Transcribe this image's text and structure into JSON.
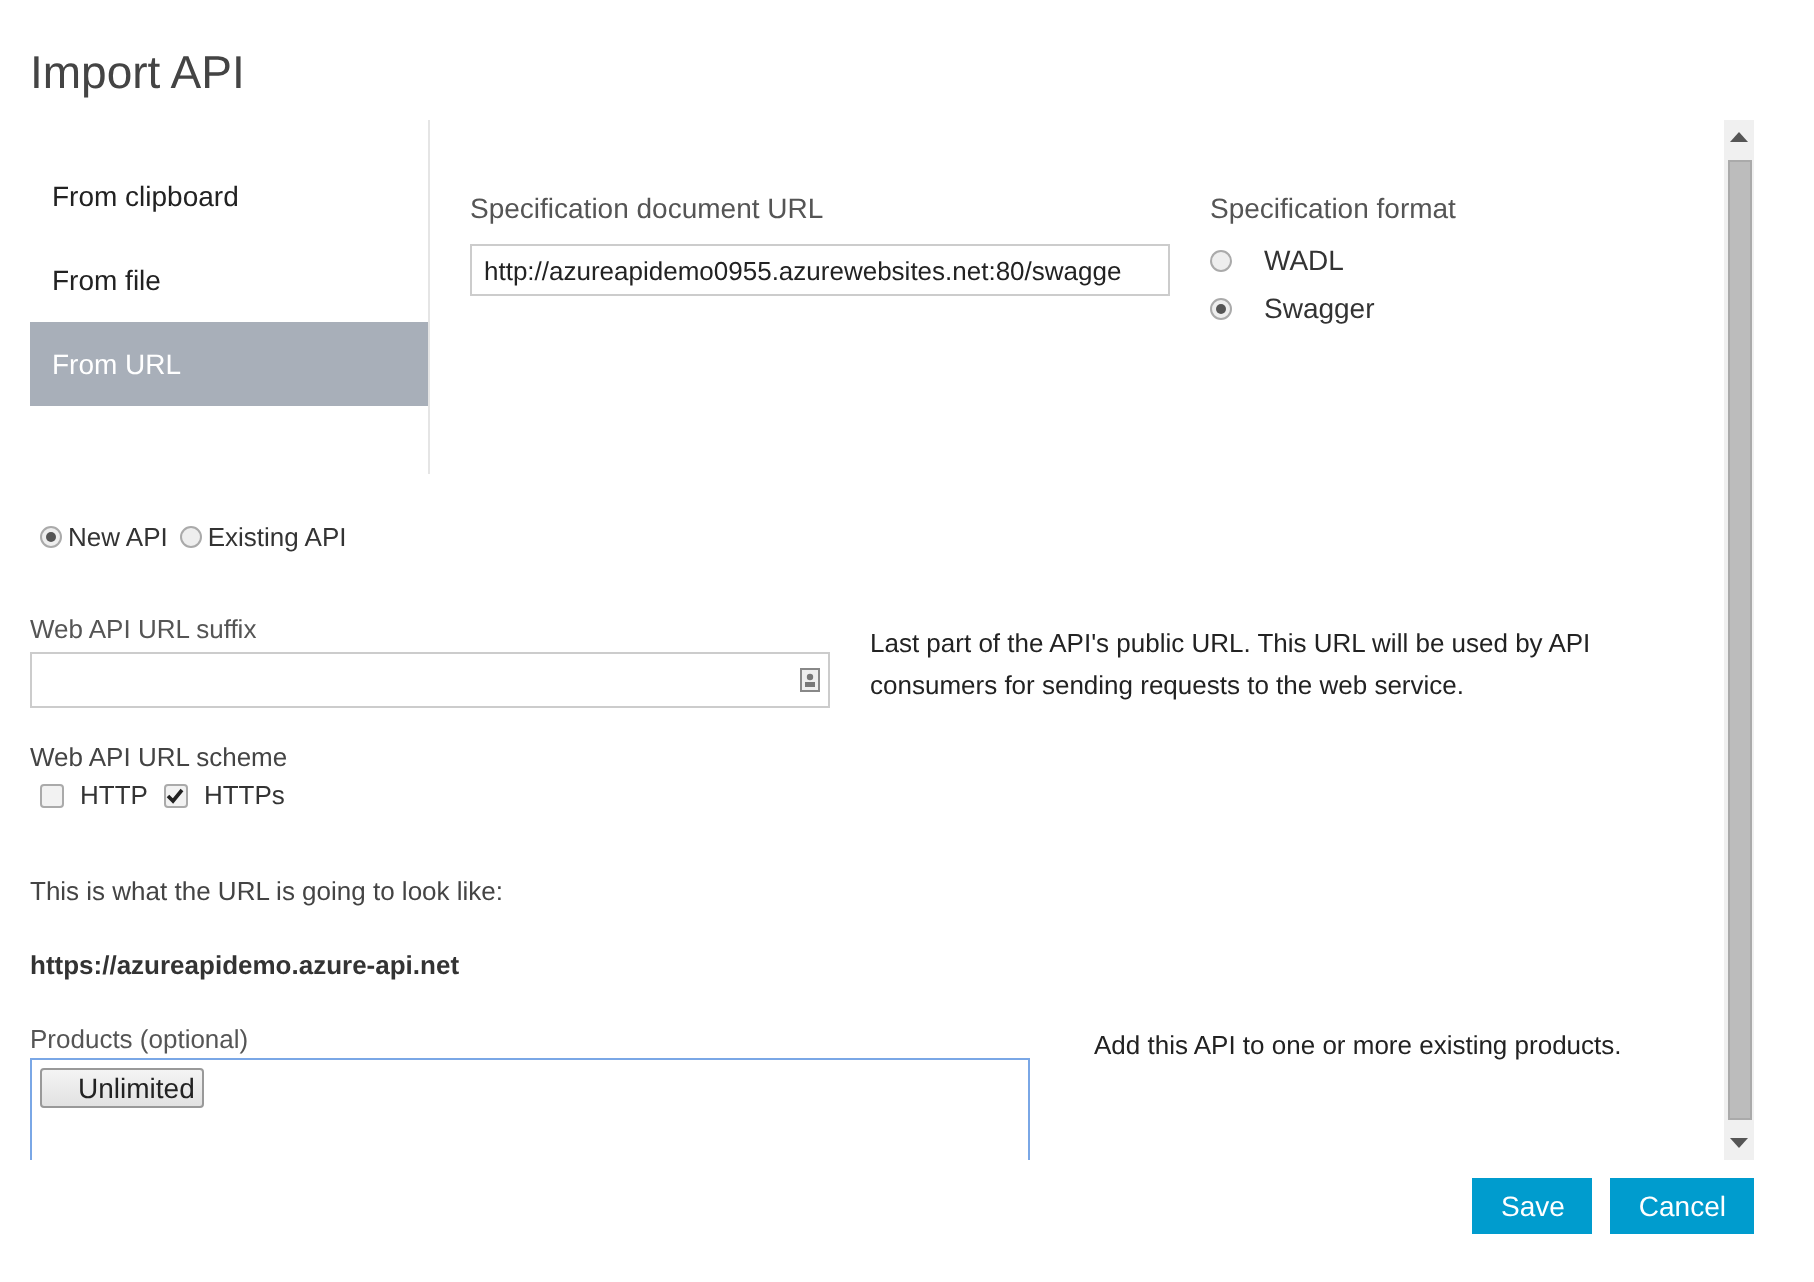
{
  "dialog": {
    "title": "Import API"
  },
  "source_tabs": [
    {
      "label": "From clipboard",
      "selected": false
    },
    {
      "label": "From file",
      "selected": false
    },
    {
      "label": "From URL",
      "selected": true
    }
  ],
  "spec_url": {
    "label": "Specification document URL",
    "value": "http://azureapidemo0955.azurewebsites.net:80/swagge"
  },
  "spec_format": {
    "label": "Specification format",
    "options": [
      {
        "label": "WADL",
        "selected": false
      },
      {
        "label": "Swagger",
        "selected": true
      }
    ]
  },
  "api_mode": [
    {
      "label": "New API",
      "selected": true
    },
    {
      "label": "Existing API",
      "selected": false
    }
  ],
  "suffix": {
    "label": "Web API URL suffix",
    "help": "Last part of the API's public URL. This URL will be used by API consumers for sending requests to the web service."
  },
  "scheme": {
    "label": "Web API URL scheme",
    "options": [
      {
        "label": "HTTP",
        "checked": false
      },
      {
        "label": "HTTPs",
        "checked": true
      }
    ]
  },
  "preview": {
    "label": "This is what the URL is going to look like:",
    "url": "https://azureapidemo.azure-api.net"
  },
  "products": {
    "label": "Products (optional)",
    "tags": [
      "Unlimited"
    ],
    "help": "Add this API to one or more existing products."
  },
  "buttons": [
    "Save",
    "Cancel"
  ]
}
